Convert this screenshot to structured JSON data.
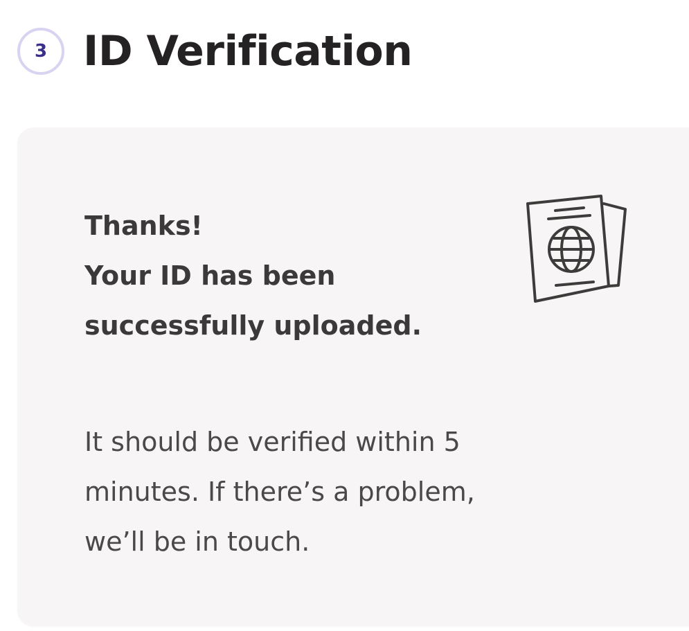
{
  "step": {
    "number": "3",
    "title": "ID Verification"
  },
  "card": {
    "heading": "Thanks!",
    "success_message": "Your ID has been successfully uploaded.",
    "verification_message": "It should be verified within 5 minutes. If there’s a problem, we’ll be in touch.",
    "icon": "passport-icon"
  },
  "colors": {
    "badge_border": "#d9d3f1",
    "badge_text": "#3b2f8c",
    "card_background": "#f7f5f6",
    "text_primary": "#242222",
    "text_secondary": "#4a4848"
  }
}
